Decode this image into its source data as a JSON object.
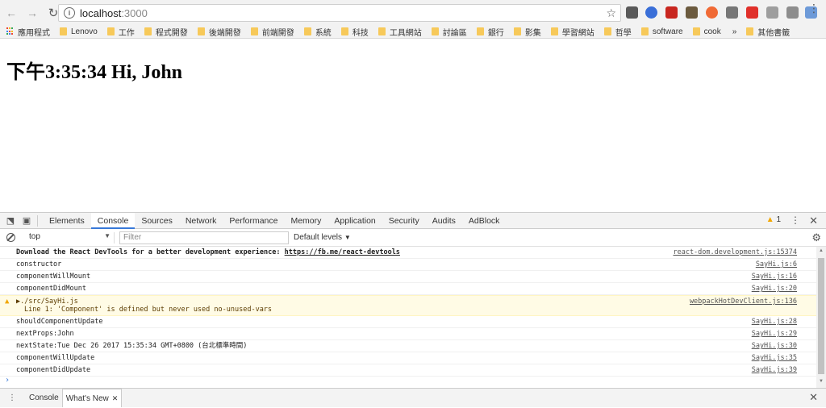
{
  "browser": {
    "url_host": "localhost",
    "url_port": ":3000",
    "icons": {
      "back": "back-arrow-icon",
      "forward": "forward-arrow-icon",
      "reload": "reload-icon",
      "info": "info-icon",
      "star": "bookmark-star-icon",
      "menu": "kebab-menu-icon"
    },
    "extensions_colors": [
      "#5a5a5a",
      "#3a6fd8",
      "#c8261f",
      "#6b5a3e",
      "#f06a35",
      "#777777",
      "#e0302a",
      "#9e9e9e",
      "#8d8d8d",
      "#6d9ad8"
    ]
  },
  "bookmarks": {
    "items": [
      "應用程式",
      "Lenovo",
      "工作",
      "程式開發",
      "後端開發",
      "前端開發",
      "系統",
      "科技",
      "工具網站",
      "討論區",
      "銀行",
      "影集",
      "學習網站",
      "哲學",
      "software",
      "cook"
    ],
    "more": "»",
    "other": "其他書籤",
    "apps_colors": [
      "#ea4335",
      "#fbbc05",
      "#34a853",
      "#4285f4",
      "#ea4335",
      "#fbbc05",
      "#34a853",
      "#4285f4",
      "#ea4335"
    ]
  },
  "page": {
    "heading": "下午3:35:34 Hi, John"
  },
  "devtools": {
    "tabs": [
      "Elements",
      "Console",
      "Sources",
      "Network",
      "Performance",
      "Memory",
      "Application",
      "Security",
      "Audits",
      "AdBlock"
    ],
    "active_tab": "Console",
    "warning_count": "1",
    "context": "top",
    "filter_placeholder": "Filter",
    "levels": "Default levels",
    "messages": [
      {
        "text": "Download the React DevTools for a better development experience: ",
        "link": "https://fb.me/react-devtools",
        "source": "react-dom.development.js:15374",
        "bold": true
      },
      {
        "text": "constructor",
        "source": "SayHi.js:6"
      },
      {
        "text": "componentWillMount",
        "source": "SayHi.js:16"
      },
      {
        "text": "componentDidMount",
        "source": "SayHi.js:20"
      },
      {
        "text": "▶./src/SayHi.js",
        "detail": "Line 1:  'Component' is defined but never used  no-unused-vars",
        "source": "webpackHotDevClient.js:136",
        "warn": true
      },
      {
        "text": "shouldComponentUpdate",
        "source": "SayHi.js:28"
      },
      {
        "text": "nextProps:John",
        "source": "SayHi.js:29"
      },
      {
        "text": "nextState:Tue Dec 26 2017 15:35:34 GMT+0800 (台北標準時間)",
        "source": "SayHi.js:30"
      },
      {
        "text": "componentWillUpdate",
        "source": "SayHi.js:35"
      },
      {
        "text": "componentDidUpdate",
        "source": "SayHi.js:39"
      }
    ],
    "prompt": "›",
    "drawer_tabs": [
      "Console",
      "What's New"
    ],
    "drawer_active": "What's New"
  }
}
